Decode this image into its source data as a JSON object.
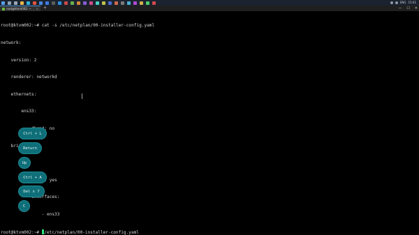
{
  "window": {
    "tab_title": "root@ktvm002: ~",
    "tab_close": "×",
    "new_tab": "+",
    "controls": [
      "—",
      "☐",
      "✕"
    ]
  },
  "taskbar": {
    "icons": [
      {
        "name": "start-icon",
        "color": "#5aa0e6"
      },
      {
        "name": "search-icon",
        "color": "#8fa2b8"
      },
      {
        "name": "taskview-icon",
        "color": "#9aa8b6"
      },
      {
        "name": "explorer-icon",
        "color": "#e8b64a"
      },
      {
        "name": "edge-icon",
        "color": "#2fb1e0"
      },
      {
        "name": "chrome-icon",
        "color": "#e0533d"
      },
      {
        "name": "store-icon",
        "color": "#4a86d9"
      },
      {
        "name": "mail-icon",
        "color": "#3d7be0"
      },
      {
        "name": "terminal-icon",
        "color": "#5c5c5c"
      },
      {
        "name": "vscode-icon",
        "color": "#2a8fdc"
      },
      {
        "name": "app-icon",
        "color": "#c94a4a"
      },
      {
        "name": "app2-icon",
        "color": "#6ab04c"
      },
      {
        "name": "app3-icon",
        "color": "#d1883a"
      },
      {
        "name": "app4-icon",
        "color": "#8a5cd1"
      },
      {
        "name": "app5-icon",
        "color": "#d14a8a"
      },
      {
        "name": "app6-icon",
        "color": "#4ad1c1"
      },
      {
        "name": "app7-icon",
        "color": "#c1c14a"
      },
      {
        "name": "app8-icon",
        "color": "#4a6ad1"
      },
      {
        "name": "app9-icon",
        "color": "#d16a4a"
      },
      {
        "name": "app10-icon",
        "color": "#7a7a7a"
      },
      {
        "name": "app11-icon",
        "color": "#4ab0d1"
      },
      {
        "name": "app12-icon",
        "color": "#b04ad1"
      },
      {
        "name": "app13-icon",
        "color": "#d1b04a"
      },
      {
        "name": "app14-icon",
        "color": "#4ad16a"
      },
      {
        "name": "app15-icon",
        "color": "#d14a4a"
      }
    ],
    "language": "ENG",
    "time": "15:01"
  },
  "terminal": {
    "lines": [
      "root@ktvm002:~# cat -s /etc/netplan/00-installer-config.yaml",
      "network:",
      "    version: 2",
      "    renderer: networkd",
      "    ethernets:",
      "        ens33:",
      "            dhcp4: no",
      "    bridges:",
      "        br0:",
      "            dhcp4: yes",
      "            interfaces:",
      "                - ens33"
    ],
    "prompt": "root@ktvm002:~# ",
    "current_input": "/etc/netplan/00-installer-config.yaml"
  },
  "key_overlay": [
    "Ctrl + L",
    "Return",
    "Up",
    "Ctrl + A",
    "Del x 7",
    "C"
  ]
}
